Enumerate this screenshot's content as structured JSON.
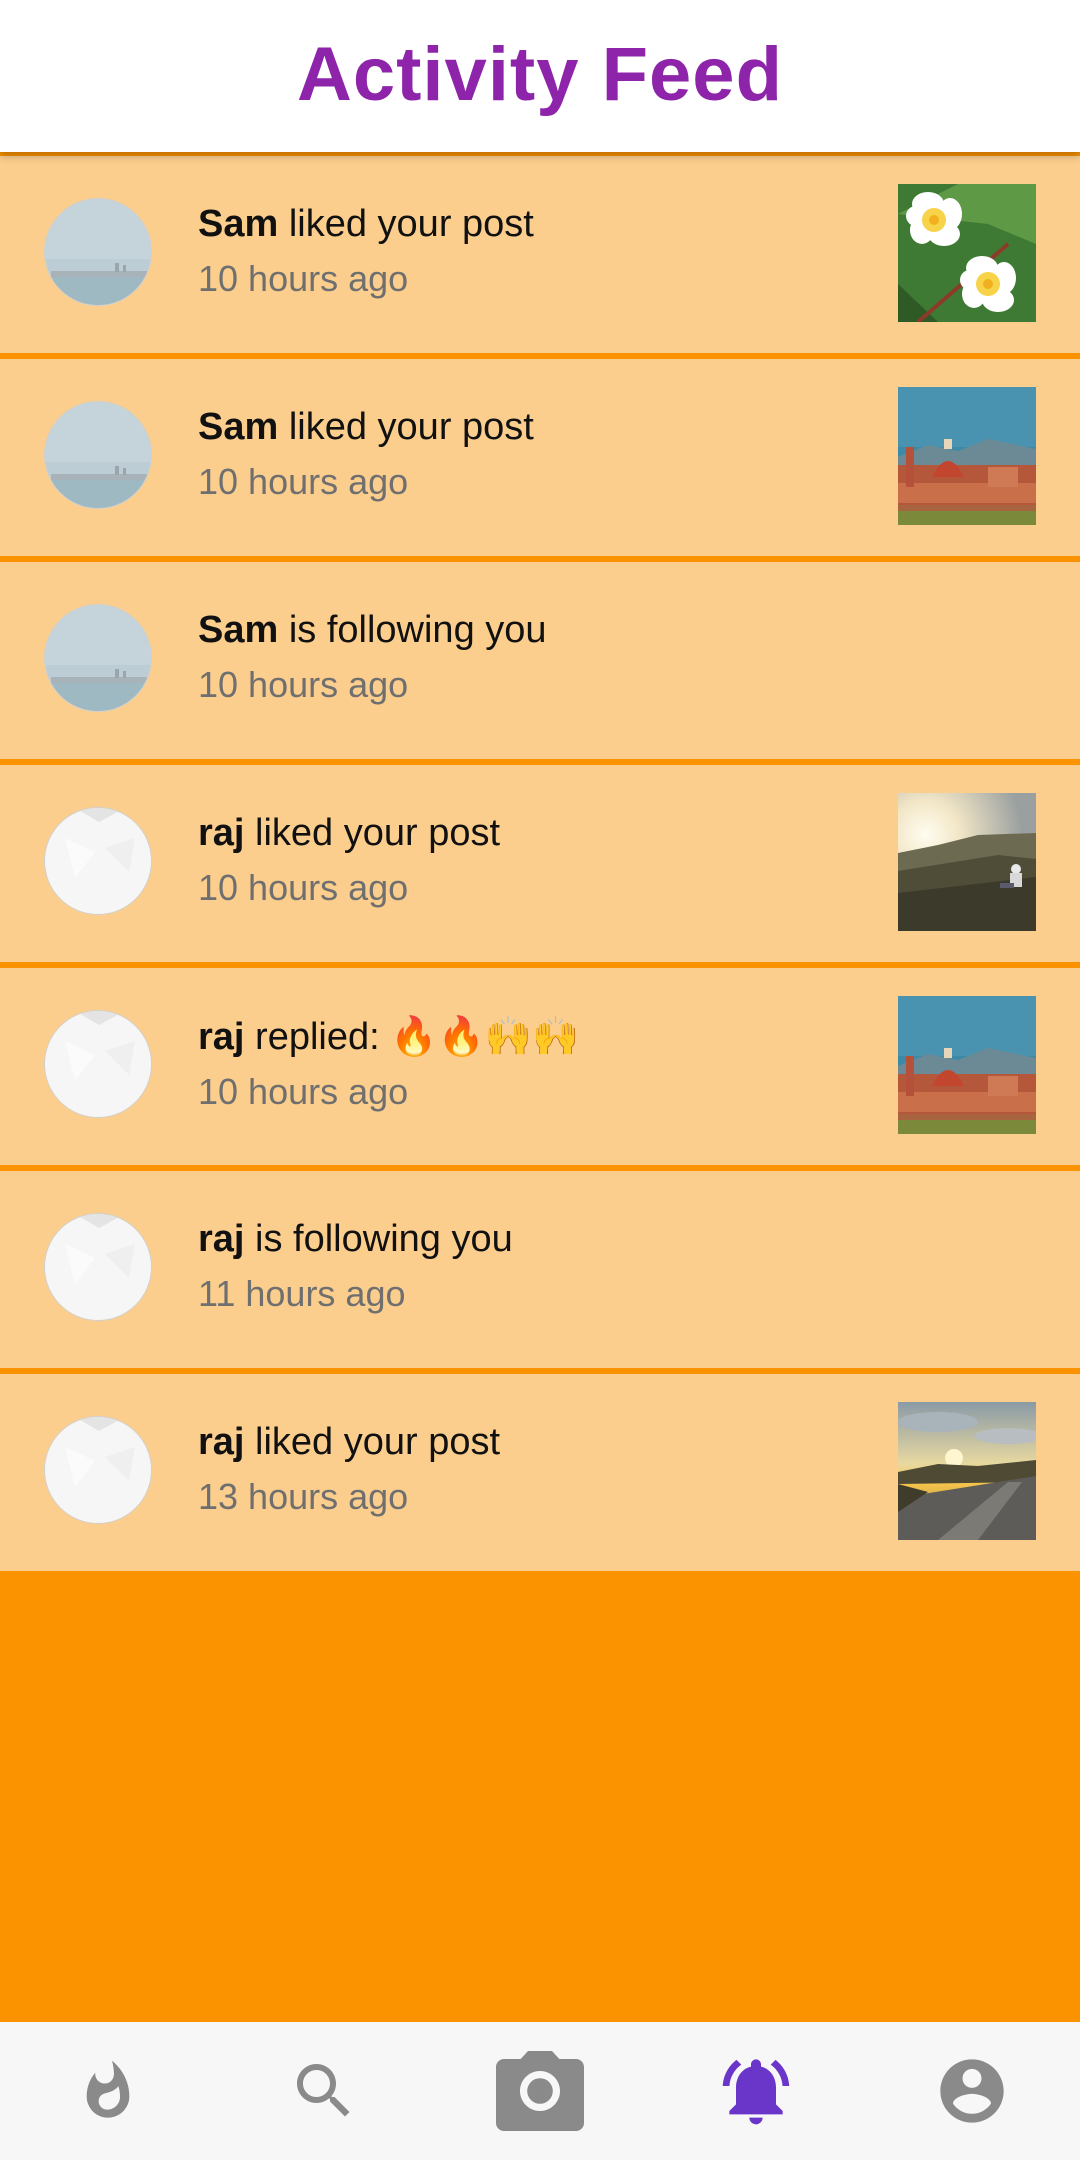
{
  "app_bar": {
    "title": "Activity Feed"
  },
  "feed": {
    "items": [
      {
        "user": "Sam",
        "action": " liked your post",
        "time": "10 hours ago",
        "avatar": "sam",
        "thumbnail": "flowers"
      },
      {
        "user": "Sam",
        "action": " liked your post",
        "time": "10 hours ago",
        "avatar": "sam",
        "thumbnail": "city"
      },
      {
        "user": "Sam",
        "action": " is following you",
        "time": "10 hours ago",
        "avatar": "sam",
        "thumbnail": "none"
      },
      {
        "user": "raj",
        "action": " liked your post",
        "time": "10 hours ago",
        "avatar": "raj",
        "thumbnail": "hills"
      },
      {
        "user": "raj",
        "action": " replied: ",
        "emoji": "🔥🔥🙌🙌",
        "time": "10 hours ago",
        "avatar": "raj",
        "thumbnail": "city"
      },
      {
        "user": "raj",
        "action": " is following you",
        "time": "11 hours ago",
        "avatar": "raj",
        "thumbnail": "none"
      },
      {
        "user": "raj",
        "action": " liked your post",
        "time": "13 hours ago",
        "avatar": "raj",
        "thumbnail": "sunset-road"
      }
    ]
  },
  "bottom_nav": {
    "items": [
      {
        "name": "timeline",
        "icon": "whatshot-icon",
        "active": false
      },
      {
        "name": "search",
        "icon": "search-icon",
        "active": false
      },
      {
        "name": "upload",
        "icon": "camera-icon",
        "active": false
      },
      {
        "name": "activity-feed",
        "icon": "notifications-icon",
        "active": true
      },
      {
        "name": "profile",
        "icon": "account-circle-icon",
        "active": false
      }
    ]
  },
  "colors": {
    "title": "#8E24AA",
    "background": "#FB9300",
    "item_background": "#FCCE8D",
    "nav_active": "#6A35C9",
    "nav_inactive": "#8A8A8A"
  }
}
